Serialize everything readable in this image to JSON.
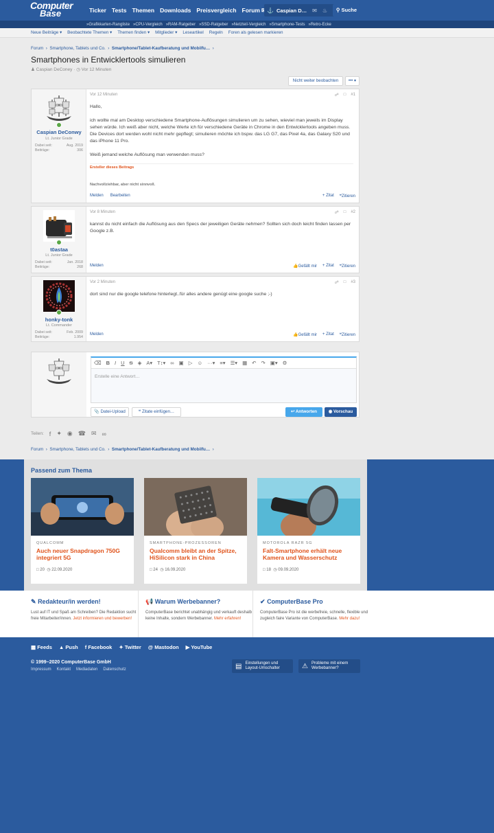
{
  "header": {
    "logo_line1": "Computer",
    "logo_line2": "Base",
    "nav": [
      "Ticker",
      "Tests",
      "Themen",
      "Downloads",
      "Preisvergleich",
      "Forum"
    ],
    "user": "Caspian D…",
    "search": "Suche"
  },
  "subnav": [
    "»Grafikkarten-Rangliste",
    "»CPU-Vergleich",
    "»RAM-Ratgeber",
    "»SSD-Ratgeber",
    "»Netzteil-Vergleich",
    "»Smartphone-Tests",
    "»Retro-Ecke"
  ],
  "secnav": [
    "Neue Beiträge ▾",
    "Beobachtete Themen ▾",
    "Themen finden ▾",
    "Mitglieder ▾",
    "Leseartikel",
    "Regeln",
    "Foren als gelesen markieren"
  ],
  "breadcrumb": {
    "c1": "Forum",
    "c2": "Smartphone, Tablets und Co.",
    "c3": "Smartphone/Tablet-Kaufberatung und Mobilfu…"
  },
  "thread": {
    "title": "Smartphones in Entwicklertools simulieren",
    "author": "Caspian DeConey",
    "age": "Vor 12 Minuten",
    "watch": "Nicht weiter beobachten",
    "more": "••• ▾"
  },
  "posts": [
    {
      "time": "Vor 12 Minuten",
      "num": "#1",
      "user": "Caspian DeConwy",
      "rank": "Lt. Junior Grade",
      "since_label": "Dabei seit:",
      "since": "Aug. 2019",
      "count_label": "Beiträge:",
      "count": "306",
      "p1": "Hallo,",
      "p2": "ich wollte mal am Desktop verschiedene Smartphone-Auflösungen simulieren um zu sehen, wieviel man jeweils im Display sehen würde. Ich weiß aber nicht, welche Werte ich für verschiedene Geräte in Chrome in den Entwicklertools angeben muss. Die Devices dort werden wohl nicht mehr gepflegt; simulieren möchte ich bspw. das LG G7, das Pixel 4a, das Galaxy S20 und das iPhone 11 Pro.",
      "p3": "Weiß jemand welche Auflösung man verwenden muss?",
      "tag": "Ersteller dieses Beitrags",
      "sig": "Nachvollziehbar, aber nicht sinnvoll.",
      "report": "Melden",
      "edit": "Bearbeiten",
      "quote": "+ Zitat",
      "reply": "Zitieren"
    },
    {
      "time": "Vor 8 Minuten",
      "num": "#2",
      "user": "t0astaa",
      "rank": "Lt. Junior Grade",
      "since_label": "Dabei seit:",
      "since": "Jan. 2018",
      "count_label": "Beiträge:",
      "count": "268",
      "p1": "kannst du nicht einfach die Auflösung aus den Specs der jeweiligen Geräte nehmen? Sollten sich doch leicht finden lassen per Google z.B.",
      "report": "Melden",
      "like": "Gefällt mir",
      "quote": "+ Zitat",
      "reply": "Zitieren"
    },
    {
      "time": "Vor 2 Minuten",
      "num": "#3",
      "user": "honky-tonk",
      "rank": "Lt. Commander",
      "since_label": "Dabei seit:",
      "since": "Feb. 2009",
      "count_label": "Beiträge:",
      "count": "1.954",
      "p1": "dort sind nur die google telefone hinterlegt..für alles andere genügt eine google suche ;-)",
      "report": "Melden",
      "like": "Gefällt mir",
      "quote": "+ Zitat",
      "reply": "Zitieren"
    }
  ],
  "editor": {
    "placeholder": "Erstelle eine Antwort…",
    "upload": "Datei-Upload",
    "insert_quotes": "Zitate einfügen…",
    "submit": "Antworten",
    "preview": "Vorschau"
  },
  "share": {
    "label": "Teilen:"
  },
  "related": {
    "title": "Passend zum Thema",
    "cards": [
      {
        "kicker": "Qualcomm",
        "title": "Auch neuer Snapdragon 750G integriert 5G",
        "comments": "20",
        "date": "22.09.2020"
      },
      {
        "kicker": "Smartphone-Prozessoren",
        "title": "Qualcomm bleibt an der Spitze, HiSilicon stark in China",
        "comments": "24",
        "date": "16.09.2020"
      },
      {
        "kicker": "Motorola Razr 5G",
        "title": "Falt-Smartphone erhält neue Kamera und Wasserschutz",
        "comments": "18",
        "date": "09.09.2020"
      }
    ]
  },
  "promo": [
    {
      "title": "Redakteur/in werden!",
      "text": "Lust auf IT und Spaß am Schreiben? Die Redaktion sucht freie Mitarbeiter/innen.",
      "link": "Jetzt informieren und bewerben!"
    },
    {
      "title": "Warum Werbebanner?",
      "text": "ComputerBase berichtet unabhängig und verkauft deshalb keine Inhalte, sondern Werbebanner.",
      "link": "Mehr erfahren!"
    },
    {
      "title": "ComputerBase Pro",
      "text": "ComputerBase Pro ist die werbefreie, schnelle, flexible und zugleich faire Variante von ComputerBase.",
      "link": "Mehr dazu!"
    }
  ],
  "footer": {
    "social": [
      "Feeds",
      "Push",
      "Facebook",
      "Twitter",
      "Mastodon",
      "YouTube"
    ],
    "copyright": "© 1999–2020 ComputerBase GmbH",
    "links": [
      "Impressum",
      "Kontakt",
      "Mediadaten",
      "Datenschutz"
    ],
    "btn1": "Einstellungen und Layout-Umschalter",
    "btn2": "Probleme mit einem Werbebanner?"
  }
}
